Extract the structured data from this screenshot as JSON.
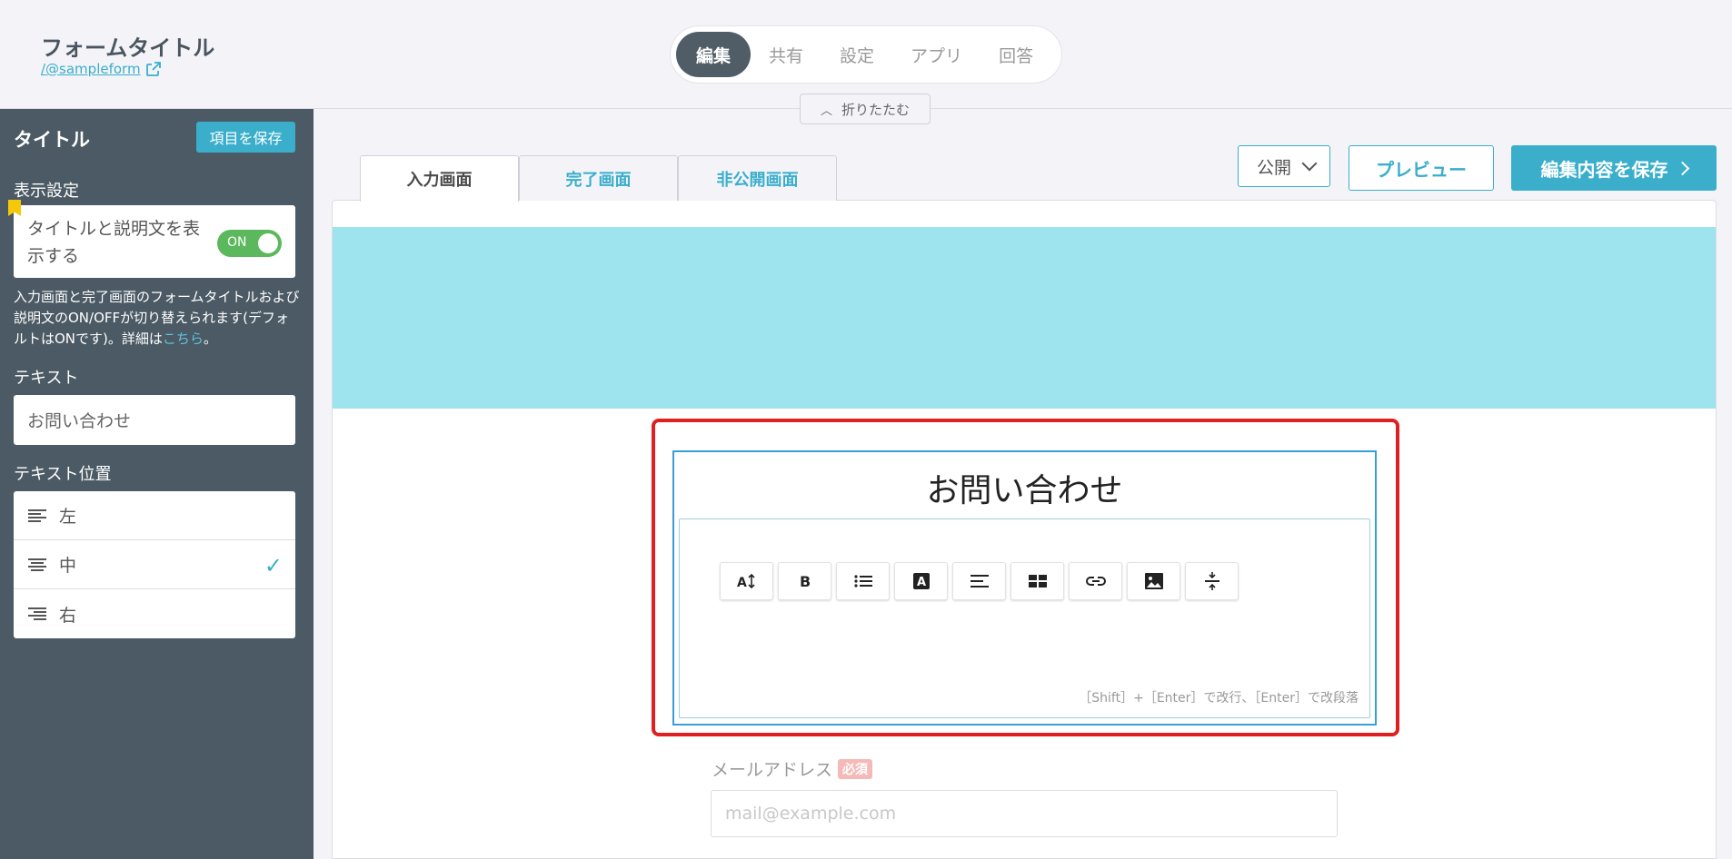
{
  "header": {
    "form_title": "フォームタイトル",
    "form_url": "/@sampleform",
    "nav": [
      {
        "label": "編集",
        "active": true
      },
      {
        "label": "共有",
        "active": false
      },
      {
        "label": "設定",
        "active": false
      },
      {
        "label": "アプリ",
        "active": false
      },
      {
        "label": "回答",
        "active": false
      }
    ],
    "collapse_label": "折りたたむ"
  },
  "sidebar": {
    "title": "タイトル",
    "save_label": "項目を保存",
    "display_section": "表示設定",
    "toggle_text": "タイトルと説明文を表示する",
    "toggle_state": "ON",
    "help_text_before": "入力画面と完了画面のフォームタイトルおよび説明文のON/OFFが切り替えられます(デフォルトはONです)。詳細は",
    "help_link": "こちら",
    "help_text_after": "。",
    "text_section": "テキスト",
    "text_value": "お問い合わせ",
    "position_section": "テキスト位置",
    "positions": [
      {
        "label": "左",
        "selected": false
      },
      {
        "label": "中",
        "selected": true
      },
      {
        "label": "右",
        "selected": false
      }
    ]
  },
  "tabs": [
    {
      "label": "入力画面",
      "active": true
    },
    {
      "label": "完了画面",
      "active": false
    },
    {
      "label": "非公開画面",
      "active": false
    }
  ],
  "actions": {
    "publish_value": "公開",
    "preview_label": "プレビュー",
    "save_label": "編集内容を保存"
  },
  "canvas": {
    "title": "お問い合わせ",
    "toolbar": [
      {
        "icon": "font-size-icon",
        "glyph": "A↕"
      },
      {
        "icon": "bold-icon",
        "glyph": "B"
      },
      {
        "icon": "list-icon",
        "glyph": ""
      },
      {
        "icon": "text-color-icon",
        "glyph": "A"
      },
      {
        "icon": "align-icon",
        "glyph": ""
      },
      {
        "icon": "table-icon",
        "glyph": ""
      },
      {
        "icon": "link-icon",
        "glyph": ""
      },
      {
        "icon": "image-icon",
        "glyph": ""
      },
      {
        "icon": "divider-icon",
        "glyph": ""
      }
    ],
    "hint": "［Shift］+［Enter］で改行、［Enter］で改段落",
    "email_label": "メールアドレス",
    "required_badge": "必須",
    "email_placeholder": "mail@example.com"
  },
  "colors": {
    "accent": "#3aaecb",
    "sidebar_bg": "#4b5a64",
    "banner": "#9ee4ee",
    "highlight": "#e02020",
    "toggle_on": "#5cb85c"
  }
}
